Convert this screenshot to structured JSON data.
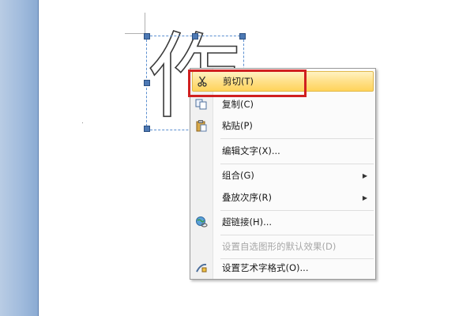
{
  "wordart": {
    "text": "作"
  },
  "menu": {
    "items": [
      {
        "label": "剪切(T)",
        "icon": "scissors-icon",
        "state": "highlighted"
      },
      {
        "label": "复制(C)",
        "icon": "copy-icon",
        "state": "normal"
      },
      {
        "label": "粘贴(P)",
        "icon": "paste-icon",
        "state": "normal"
      },
      {
        "label": "编辑文字(X)...",
        "icon": "",
        "state": "normal"
      },
      {
        "label": "组合(G)",
        "icon": "",
        "state": "normal",
        "submenu": true
      },
      {
        "label": "叠放次序(R)",
        "icon": "",
        "state": "normal",
        "submenu": true
      },
      {
        "label": "超链接(H)...",
        "icon": "hyperlink-icon",
        "state": "normal"
      },
      {
        "label": "设置自选图形的默认效果(D)",
        "icon": "",
        "state": "disabled"
      },
      {
        "label": "设置艺术字格式(O)...",
        "icon": "format-wordart-icon",
        "state": "normal"
      }
    ],
    "arrow_glyph": "▶"
  },
  "colors": {
    "highlight": "#ffd35a",
    "callout": "#d02020",
    "sidebar": "#9fbadc"
  }
}
